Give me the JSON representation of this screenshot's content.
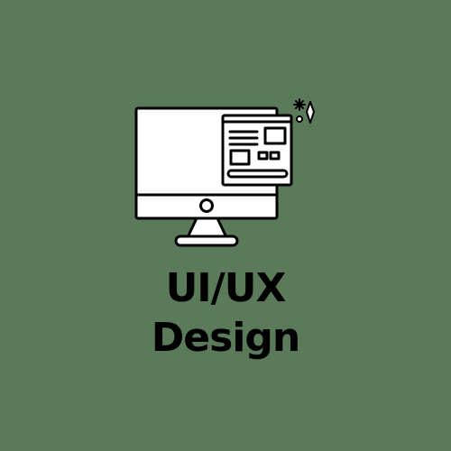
{
  "background_color": "#5a7a5a",
  "ink_color": "#000000",
  "graphic": {
    "icon": "desktop-monitor-with-ui-wireframe-icon",
    "decorations": [
      "sparkle-icon",
      "diamond-icon",
      "dot-icon"
    ]
  },
  "title": {
    "line1": "UI/UX",
    "line2": "Design"
  }
}
